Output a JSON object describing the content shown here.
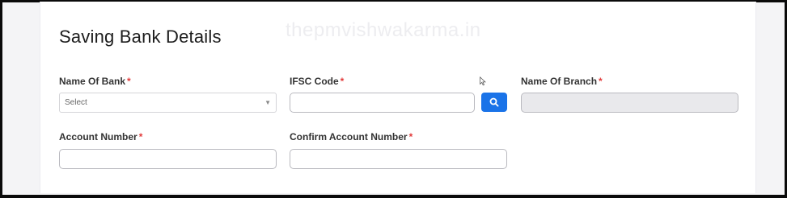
{
  "watermark": "thepmvishwakarma.in",
  "section": {
    "title": "Saving Bank Details"
  },
  "fields": {
    "bank_name": {
      "label": "Name Of Bank",
      "required": "*",
      "selected": "Select"
    },
    "ifsc": {
      "label": "IFSC Code",
      "required": "*",
      "value": ""
    },
    "branch": {
      "label": "Name Of Branch",
      "required": "*",
      "value": ""
    },
    "account_number": {
      "label": "Account Number",
      "required": "*",
      "value": ""
    },
    "confirm_account_number": {
      "label": "Confirm Account Number",
      "required": "*",
      "value": ""
    }
  },
  "icons": {
    "search_button": "search-icon",
    "caret": "chevron-down-icon",
    "cursor": "mouse-pointer-icon"
  },
  "colors": {
    "accent": "#1a73e8",
    "required": "#e23b3b",
    "disabled_bg": "#e9e9ec"
  }
}
